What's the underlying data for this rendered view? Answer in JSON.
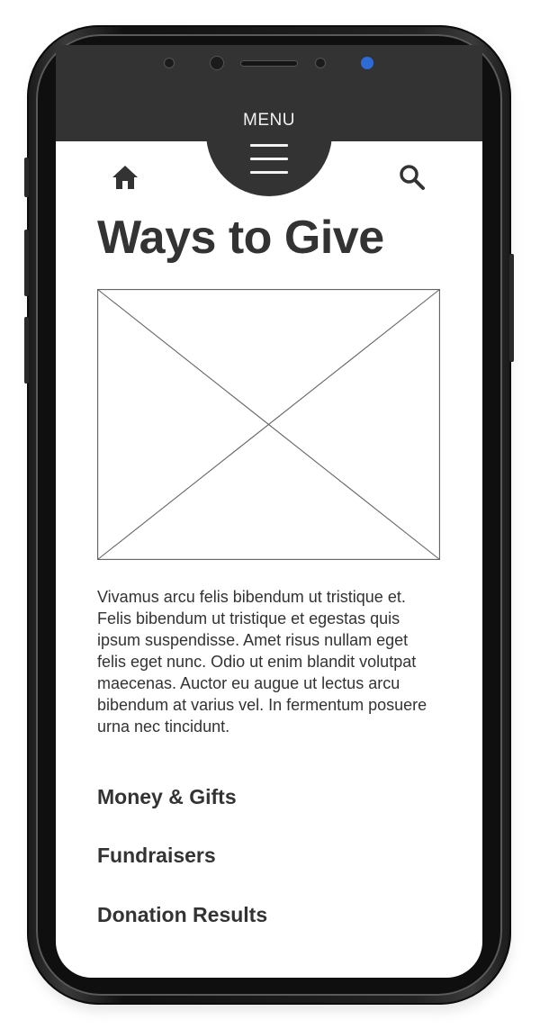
{
  "header": {
    "menu_label": "MENU"
  },
  "icons": {
    "home": "home-icon",
    "search": "search-icon",
    "menu": "hamburger-icon"
  },
  "main": {
    "title": "Ways to Give",
    "body": "Vivamus arcu felis bibendum ut tristique et. Felis bibendum ut tristique et egestas quis ipsum suspendisse. Amet risus nullam eget felis eget nunc. Odio ut enim blandit volutpat maecenas. Auctor eu augue ut lectus arcu bibendum at varius vel. In fermentum posuere urna nec tincidunt.",
    "links": [
      {
        "label": "Money & Gifts"
      },
      {
        "label": "Fundraisers"
      },
      {
        "label": "Donation Results"
      }
    ]
  },
  "colors": {
    "header_bg": "#333333",
    "text": "#333333",
    "front_camera_dot": "#2d6bd6"
  }
}
